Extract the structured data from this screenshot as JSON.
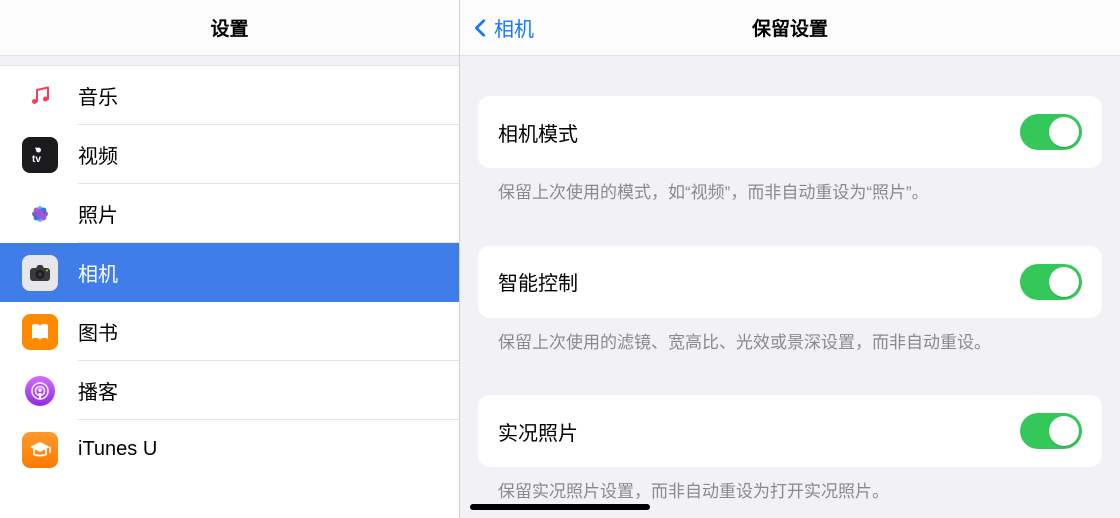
{
  "sidebar": {
    "title": "设置",
    "items": [
      {
        "id": "music",
        "label": "音乐"
      },
      {
        "id": "video",
        "label": "视频"
      },
      {
        "id": "photos",
        "label": "照片"
      },
      {
        "id": "camera",
        "label": "相机"
      },
      {
        "id": "books",
        "label": "图书"
      },
      {
        "id": "podcasts",
        "label": "播客"
      },
      {
        "id": "itunesu",
        "label": "iTunes U"
      }
    ],
    "selected": "camera"
  },
  "detail": {
    "back_label": "相机",
    "title": "保留设置",
    "groups": [
      {
        "cell_title": "相机模式",
        "switch_on": true,
        "footer": "保留上次使用的模式，如“视频”，而非自动重设为“照片”。"
      },
      {
        "cell_title": "智能控制",
        "switch_on": true,
        "footer": "保留上次使用的滤镜、宽高比、光效或景深设置，而非自动重设。"
      },
      {
        "cell_title": "实况照片",
        "switch_on": true,
        "footer": "保留实况照片设置，而非自动重设为打开实况照片。"
      }
    ]
  }
}
